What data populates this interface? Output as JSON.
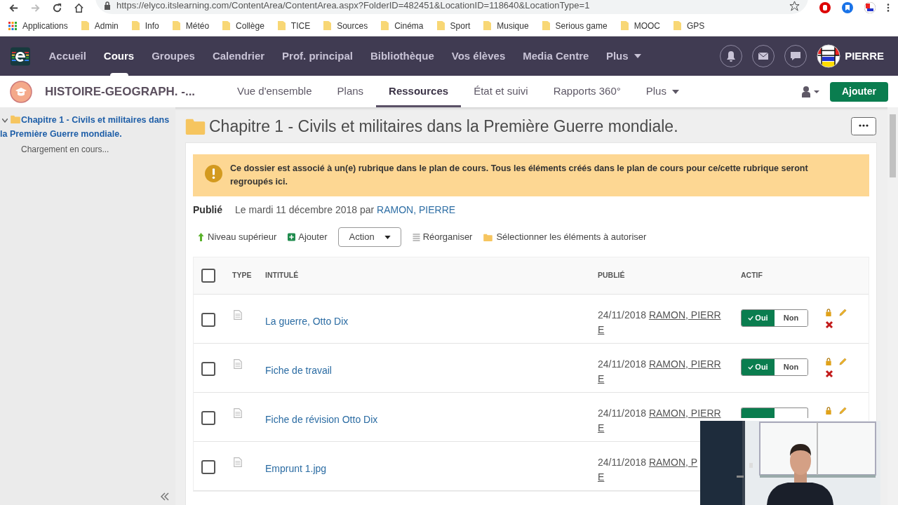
{
  "browser": {
    "url": "https://elyco.itslearning.com/ContentArea/ContentArea.aspx?FolderID=482451&LocationID=118640&LocationType=1",
    "bookmarks": [
      {
        "kind": "apps",
        "label": "Applications"
      },
      {
        "kind": "folder",
        "label": "Admin"
      },
      {
        "kind": "folder",
        "label": "Info"
      },
      {
        "kind": "folder",
        "label": "Météo"
      },
      {
        "kind": "folder",
        "label": "Collège"
      },
      {
        "kind": "folder",
        "label": "TICE"
      },
      {
        "kind": "folder",
        "label": "Sources"
      },
      {
        "kind": "folder",
        "label": "Cinéma"
      },
      {
        "kind": "folder",
        "label": "Sport"
      },
      {
        "kind": "folder",
        "label": "Musique"
      },
      {
        "kind": "folder",
        "label": "Serious game"
      },
      {
        "kind": "folder",
        "label": "MOOC"
      },
      {
        "kind": "folder",
        "label": "GPS"
      }
    ]
  },
  "nav": {
    "items": [
      {
        "label": "Accueil",
        "selected": false
      },
      {
        "label": "Cours",
        "selected": true
      },
      {
        "label": "Groupes",
        "selected": false
      },
      {
        "label": "Calendrier",
        "selected": false
      },
      {
        "label": "Prof. principal",
        "selected": false
      },
      {
        "label": "Bibliothèque",
        "selected": false
      },
      {
        "label": "Vos élèves",
        "selected": false
      },
      {
        "label": "Media Centre",
        "selected": false
      }
    ],
    "more": "Plus",
    "user": "PIERRE"
  },
  "subnav": {
    "course": "HISTOIRE-GEOGRAPH. -...",
    "tabs": [
      {
        "label": "Vue d'ensemble",
        "selected": false
      },
      {
        "label": "Plans",
        "selected": false
      },
      {
        "label": "Ressources",
        "selected": true
      },
      {
        "label": "État et suivi",
        "selected": false
      },
      {
        "label": "Rapports 360°",
        "selected": false
      }
    ],
    "more": "Plus",
    "add_button": "Ajouter"
  },
  "sidebar": {
    "tree": [
      {
        "label": "Chapitre 1 - Civils et militaires dans la Première Guerre mondiale.",
        "expanded": true,
        "children": [
          {
            "label": "Chargement en cours..."
          }
        ]
      }
    ]
  },
  "main": {
    "title": "Chapitre 1 - Civils et militaires dans la Première Guerre mondiale.",
    "notice": "Ce dossier est associé à un(e) rubrique dans le plan de cours. Tous les éléments créés dans le plan de cours pour ce/cette rubrique seront regroupés ici.",
    "published_label": "Publié",
    "published_text": "Le mardi 11 décembre 2018 par",
    "published_author": "RAMON, PIERRE",
    "toolbar": [
      {
        "kind": "up",
        "label": "Niveau supérieur"
      },
      {
        "kind": "add",
        "label": "Ajouter"
      },
      {
        "kind": "dropdown",
        "label": "Action"
      },
      {
        "kind": "reorder",
        "label": "Réorganiser"
      },
      {
        "kind": "folder",
        "label": "Sélectionner les éléments à autoriser"
      }
    ],
    "table": {
      "select_all": {
        "checked": false
      },
      "columns": [
        "TYPE",
        "INTITULÉ",
        "PUBLIÉ",
        "ACTIF"
      ],
      "rows": [
        {
          "checked": false,
          "title": "La guerre, Otto Dix",
          "date": "24/11/2018",
          "author_lines": [
            "RAMON, PIERR",
            "E"
          ],
          "toggle": {
            "on": "Oui",
            "off": "Non",
            "active": true
          },
          "icons": [
            {
              "kind": "lock"
            },
            {
              "kind": "pencil"
            },
            {
              "kind": "delete"
            }
          ]
        },
        {
          "checked": false,
          "title": "Fiche de travail",
          "date": "24/11/2018",
          "author_lines": [
            "RAMON, PIERR",
            "E"
          ],
          "toggle": {
            "on": "Oui",
            "off": "Non",
            "active": true
          },
          "icons": [
            {
              "kind": "lock"
            },
            {
              "kind": "pencil"
            },
            {
              "kind": "delete"
            }
          ]
        },
        {
          "checked": false,
          "title": "Fiche de révision Otto Dix",
          "date": "24/11/2018",
          "author_lines": [
            "RAMON, PIERR",
            "E"
          ],
          "toggle": {
            "active": true
          },
          "icons": [
            {
              "kind": "lock"
            },
            {
              "kind": "pencil"
            }
          ]
        },
        {
          "checked": false,
          "title": "Emprunt 1.jpg",
          "date": "24/11/2018",
          "author_lines": [
            "RAMON, P",
            "E"
          ]
        }
      ]
    }
  }
}
